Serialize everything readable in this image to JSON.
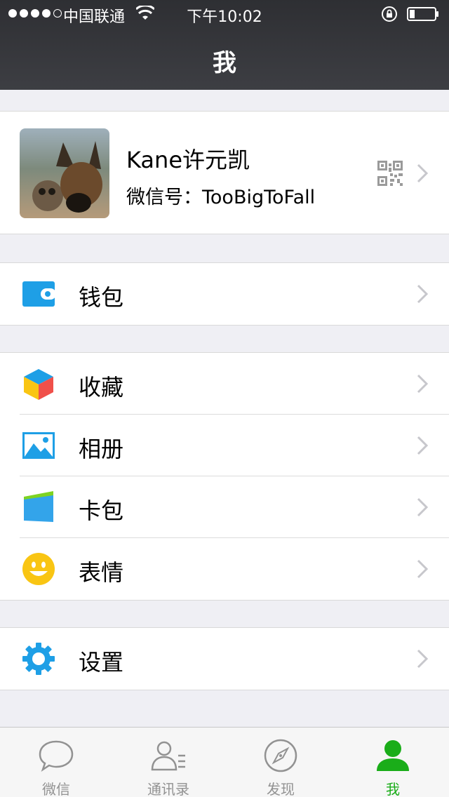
{
  "status_bar": {
    "carrier": "中国联通",
    "time": "下午10:02",
    "signal_bars": 4,
    "signal_total": 5
  },
  "nav": {
    "title": "我"
  },
  "profile": {
    "name": "Kane许元凯",
    "wechat_id_label": "微信号：",
    "wechat_id": "TooBigToFall"
  },
  "menu": {
    "wallet": {
      "label": "钱包",
      "icon": "wallet-icon"
    },
    "favorites": {
      "label": "收藏",
      "icon": "cube-icon"
    },
    "album": {
      "label": "相册",
      "icon": "photo-icon"
    },
    "cards": {
      "label": "卡包",
      "icon": "card-icon"
    },
    "stickers": {
      "label": "表情",
      "icon": "smiley-icon"
    },
    "settings": {
      "label": "设置",
      "icon": "gear-icon"
    }
  },
  "tabs": [
    {
      "label": "微信",
      "icon": "chat-bubble-icon",
      "active": false
    },
    {
      "label": "通讯录",
      "icon": "contacts-icon",
      "active": false
    },
    {
      "label": "发现",
      "icon": "compass-icon",
      "active": false
    },
    {
      "label": "我",
      "icon": "person-icon",
      "active": true
    }
  ],
  "colors": {
    "accent_green": "#1aad19",
    "icon_blue": "#1e9fe6",
    "nav_bg": "#393a3f"
  }
}
